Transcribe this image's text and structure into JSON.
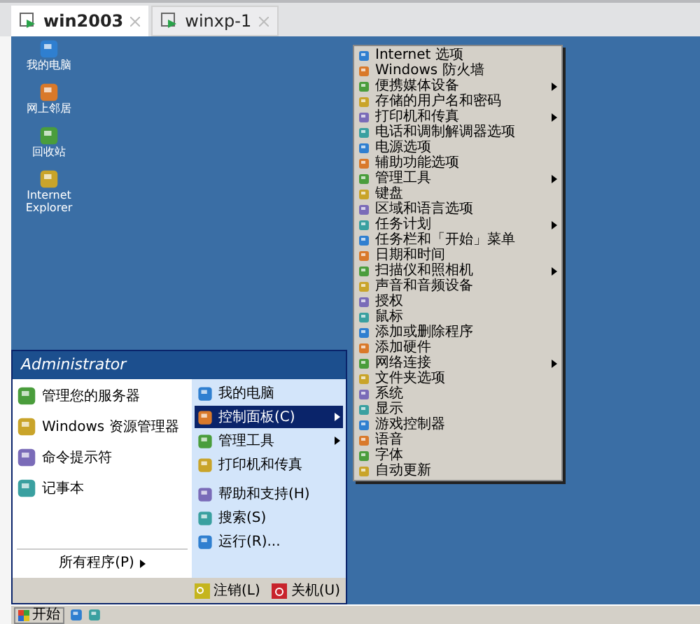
{
  "tabs": [
    {
      "label": "win2003",
      "selected": true
    },
    {
      "label": "winxp-1",
      "selected": false
    }
  ],
  "desktop_icons": [
    {
      "label": "我的电脑"
    },
    {
      "label": "网上邻居"
    },
    {
      "label": "回收站"
    },
    {
      "label": "Internet Explorer"
    }
  ],
  "control_panel_menu": [
    {
      "label": "Internet 选项",
      "has_submenu": false
    },
    {
      "label": "Windows 防火墙",
      "has_submenu": false
    },
    {
      "label": "便携媒体设备",
      "has_submenu": true
    },
    {
      "label": "存储的用户名和密码",
      "has_submenu": false
    },
    {
      "label": "打印机和传真",
      "has_submenu": true
    },
    {
      "label": "电话和调制解调器选项",
      "has_submenu": false
    },
    {
      "label": "电源选项",
      "has_submenu": false
    },
    {
      "label": "辅助功能选项",
      "has_submenu": false
    },
    {
      "label": "管理工具",
      "has_submenu": true
    },
    {
      "label": "键盘",
      "has_submenu": false
    },
    {
      "label": "区域和语言选项",
      "has_submenu": false
    },
    {
      "label": "任务计划",
      "has_submenu": true
    },
    {
      "label": "任务栏和「开始」菜单",
      "has_submenu": false
    },
    {
      "label": "日期和时间",
      "has_submenu": false
    },
    {
      "label": "扫描仪和照相机",
      "has_submenu": true
    },
    {
      "label": "声音和音频设备",
      "has_submenu": false
    },
    {
      "label": "授权",
      "has_submenu": false
    },
    {
      "label": "鼠标",
      "has_submenu": false
    },
    {
      "label": "添加或删除程序",
      "has_submenu": false
    },
    {
      "label": "添加硬件",
      "has_submenu": false
    },
    {
      "label": "网络连接",
      "has_submenu": true
    },
    {
      "label": "文件夹选项",
      "has_submenu": false
    },
    {
      "label": "系统",
      "has_submenu": false
    },
    {
      "label": "显示",
      "has_submenu": false
    },
    {
      "label": "游戏控制器",
      "has_submenu": false
    },
    {
      "label": "语音",
      "has_submenu": false
    },
    {
      "label": "字体",
      "has_submenu": false
    },
    {
      "label": "自动更新",
      "has_submenu": false
    }
  ],
  "start_menu": {
    "user": "Administrator",
    "left_items": [
      {
        "label": "管理您的服务器"
      },
      {
        "label": "Windows 资源管理器"
      },
      {
        "label": "命令提示符"
      },
      {
        "label": "记事本"
      }
    ],
    "all_programs": "所有程序(P)",
    "right_items": [
      {
        "label": "我的电脑",
        "has_submenu": false,
        "selected": false
      },
      {
        "label": "控制面板(C)",
        "has_submenu": true,
        "selected": true
      },
      {
        "label": "管理工具",
        "has_submenu": true,
        "selected": false
      },
      {
        "label": "打印机和传真",
        "has_submenu": false,
        "selected": false
      },
      {
        "label": "帮助和支持(H)",
        "has_submenu": false,
        "selected": false
      },
      {
        "label": "搜索(S)",
        "has_submenu": false,
        "selected": false
      },
      {
        "label": "运行(R)...",
        "has_submenu": false,
        "selected": false
      }
    ],
    "log_off": "注销(L)",
    "shut_down": "关机(U)"
  },
  "taskbar": {
    "start": "开始"
  }
}
